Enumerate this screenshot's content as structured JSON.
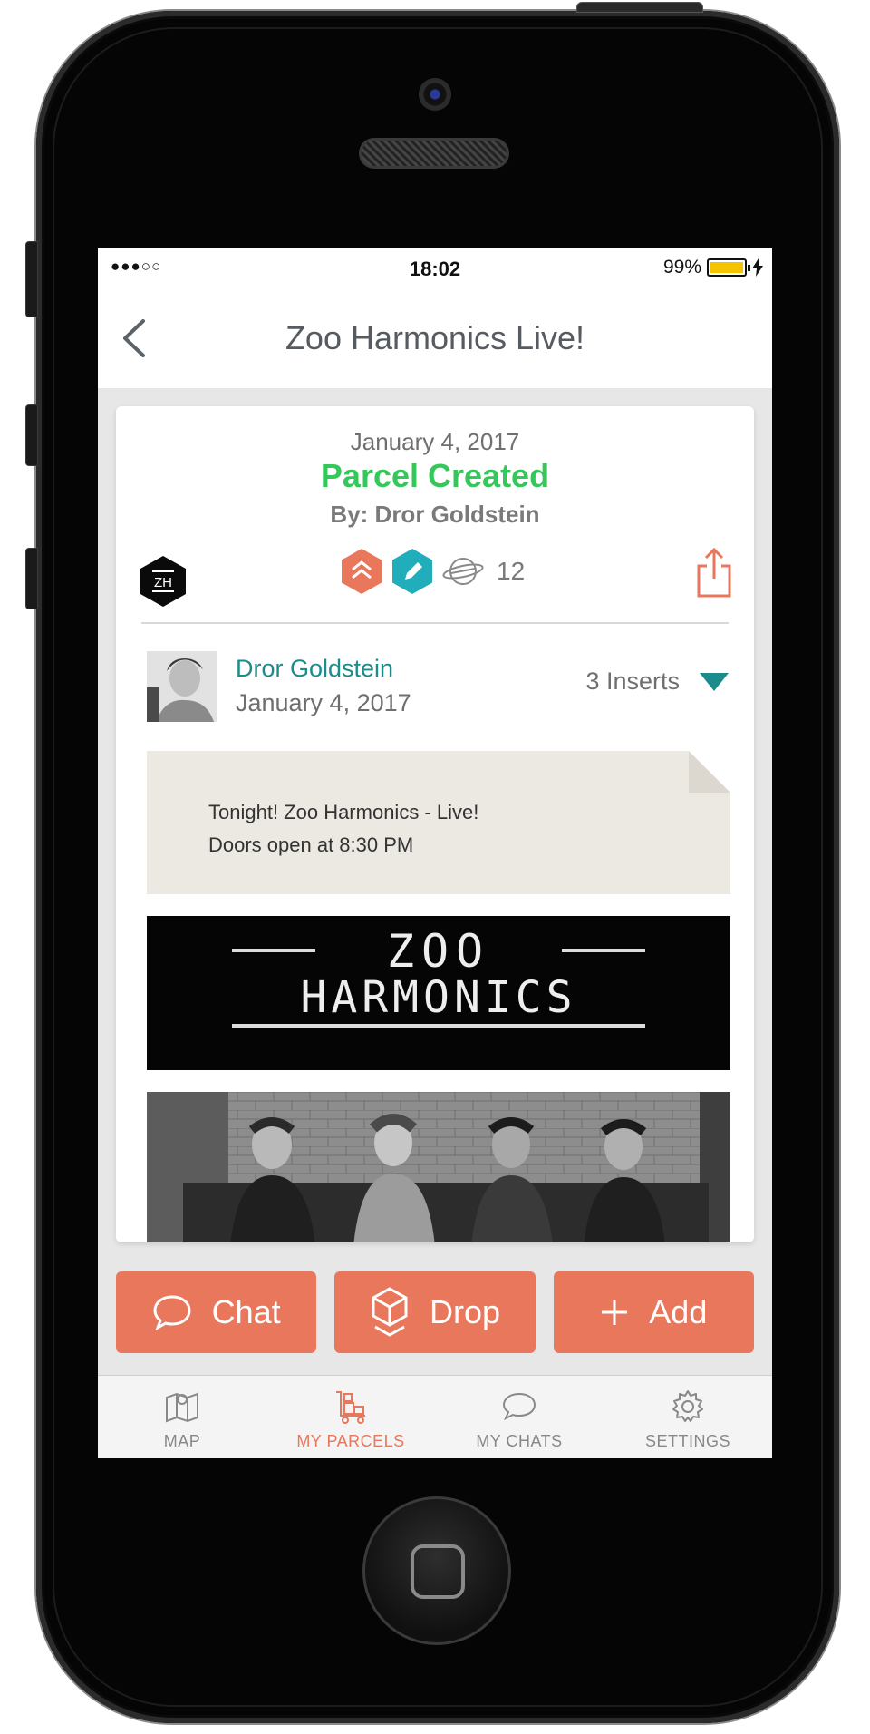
{
  "status_bar": {
    "signal": "●●●○○",
    "time": "18:02",
    "battery": "99%",
    "battery_level": 0.99
  },
  "nav": {
    "title": "Zoo Harmonics Live!"
  },
  "parcel": {
    "date": "January 4, 2017",
    "status": "Parcel Created",
    "by": "By: Dror Goldstein",
    "logo_text": "ZH",
    "count": "12"
  },
  "insert": {
    "author": "Dror Goldstein",
    "date": "January 4, 2017",
    "inserts_label": "3 Inserts",
    "note_line1": "Tonight! Zoo Harmonics - Live!",
    "note_line2": "Doors open at 8:30 PM",
    "banner_line1": "ZOO",
    "banner_line2": "HARMONICS"
  },
  "actions": {
    "chat": "Chat",
    "drop": "Drop",
    "add": "Add"
  },
  "tabs": [
    {
      "label": "MAP",
      "icon": "map-icon"
    },
    {
      "label": "MY PARCELS",
      "icon": "parcels-icon"
    },
    {
      "label": "MY CHATS",
      "icon": "chat-bubble-icon"
    },
    {
      "label": "SETTINGS",
      "icon": "gear-icon"
    }
  ],
  "colors": {
    "accent": "#e8775c",
    "teal": "#1b8c8c",
    "success": "#34c759",
    "battery": "#f5c400"
  }
}
